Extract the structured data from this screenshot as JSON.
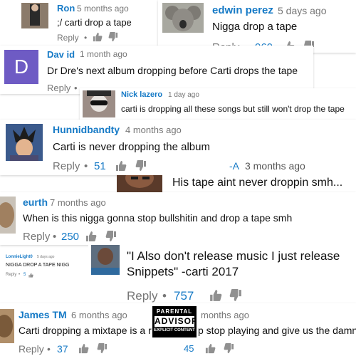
{
  "comments": [
    {
      "id": "ron",
      "author": "Ron",
      "time": "5 months ago",
      "text": ";/ carti drop a tape",
      "reply": "Reply",
      "likes": ""
    },
    {
      "id": "edwin",
      "author": "edwin perez",
      "time": "5 days ago",
      "text": "Nigga drop a tape",
      "reply": "Reply",
      "likes": "960"
    },
    {
      "id": "david",
      "avatar_letter": "D",
      "author": "Dav id",
      "time": "1 month ago",
      "text": "Dr Dre's next album dropping before Carti drops the tape",
      "reply": "Reply",
      "likes": ""
    },
    {
      "id": "nick",
      "author": "Nick lazero",
      "time": "1 day ago",
      "text": "carti is dropping all these songs but still won't drop the tape"
    },
    {
      "id": "hunnid",
      "author": "Hunnidbandty",
      "time": "4 months ago",
      "text": "Carti is never dropping the album",
      "reply": "Reply",
      "likes": "51"
    },
    {
      "id": "a",
      "author": "-A",
      "time": "3 months ago",
      "text": "His tape aint never droppin smh..."
    },
    {
      "id": "eurth",
      "author": "eurth",
      "time": "7 months ago",
      "text": "When is this nigga gonna stop bullshitin and drop a tape smh",
      "reply": "Reply",
      "likes": "250"
    },
    {
      "id": "lonnie",
      "author": "LonnieLight0",
      "time": "5 days ago",
      "text": "NIGGA DROP A TAPE NIGG",
      "reply": "Reply",
      "likes": "5"
    },
    {
      "id": "quote",
      "text_line1": "\"I Also don't release music I just release",
      "text_line2": "Snippets\" -carti 2017",
      "reply": "Reply",
      "likes": "757"
    },
    {
      "id": "james",
      "author": "James TM",
      "time": "6 months ago",
      "time_right": "months ago",
      "text_left": "Carti dropping a mixtape is a r",
      "text_right": "p stop playing and give us the damn tap",
      "reply": "Reply",
      "likes": "37",
      "likes_right": "45"
    }
  ],
  "sticker": {
    "line1": "PARENTAL",
    "line2": "ADVISORY",
    "line3": "EXPLICIT CONTENT"
  },
  "colors": {
    "link": "#167ac6",
    "meta": "#767676",
    "icon": "#909090",
    "avatar_d": "#6e5bc4"
  },
  "icons": [
    "thumbs-up-icon",
    "thumbs-down-icon"
  ]
}
